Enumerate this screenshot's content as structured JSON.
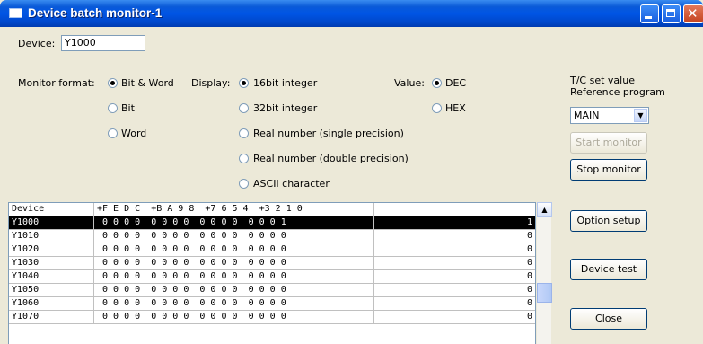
{
  "window": {
    "title": "Device batch monitor-1",
    "close_glyph": "✕"
  },
  "device": {
    "label": "Device:",
    "value": "Y1000"
  },
  "monitor_format": {
    "label": "Monitor format:",
    "options": [
      {
        "label": "Bit & Word",
        "selected": true
      },
      {
        "label": "Bit",
        "selected": false
      },
      {
        "label": "Word",
        "selected": false
      }
    ]
  },
  "display": {
    "label": "Display:",
    "options": [
      {
        "label": "16bit integer",
        "selected": true
      },
      {
        "label": "32bit integer",
        "selected": false
      },
      {
        "label": "Real number (single precision)",
        "selected": false
      },
      {
        "label": "Real number (double precision)",
        "selected": false
      },
      {
        "label": "ASCII character",
        "selected": false
      }
    ]
  },
  "value": {
    "label": "Value:",
    "options": [
      {
        "label": "DEC",
        "selected": true
      },
      {
        "label": "HEX",
        "selected": false
      }
    ]
  },
  "tc": {
    "line1": "T/C set value",
    "line2": "Reference program",
    "program_select": "MAIN",
    "dropdown_glyph": "▼"
  },
  "buttons": {
    "start_monitor": "Start monitor",
    "stop_monitor": "Stop monitor",
    "option_setup": "Option setup",
    "device_test": "Device test",
    "close": "Close"
  },
  "table": {
    "headers": [
      "Device",
      "+F E D C  +B A 9 8  +7 6 5 4  +3 2 1 0",
      ""
    ],
    "selected_row": 0,
    "rows": [
      {
        "device": "Y1000",
        "bits": " 0 0 0 0  0 0 0 0  0 0 0 0  0 0 0 1",
        "value": "1"
      },
      {
        "device": "Y1010",
        "bits": " 0 0 0 0  0 0 0 0  0 0 0 0  0 0 0 0",
        "value": "0"
      },
      {
        "device": "Y1020",
        "bits": " 0 0 0 0  0 0 0 0  0 0 0 0  0 0 0 0",
        "value": "0"
      },
      {
        "device": "Y1030",
        "bits": " 0 0 0 0  0 0 0 0  0 0 0 0  0 0 0 0",
        "value": "0"
      },
      {
        "device": "Y1040",
        "bits": " 0 0 0 0  0 0 0 0  0 0 0 0  0 0 0 0",
        "value": "0"
      },
      {
        "device": "Y1050",
        "bits": " 0 0 0 0  0 0 0 0  0 0 0 0  0 0 0 0",
        "value": "0"
      },
      {
        "device": "Y1060",
        "bits": " 0 0 0 0  0 0 0 0  0 0 0 0  0 0 0 0",
        "value": "0"
      },
      {
        "device": "Y1070",
        "bits": " 0 0 0 0  0 0 0 0  0 0 0 0  0 0 0 0",
        "value": "0"
      }
    ]
  },
  "scrollbar": {
    "up_glyph": "▲"
  }
}
